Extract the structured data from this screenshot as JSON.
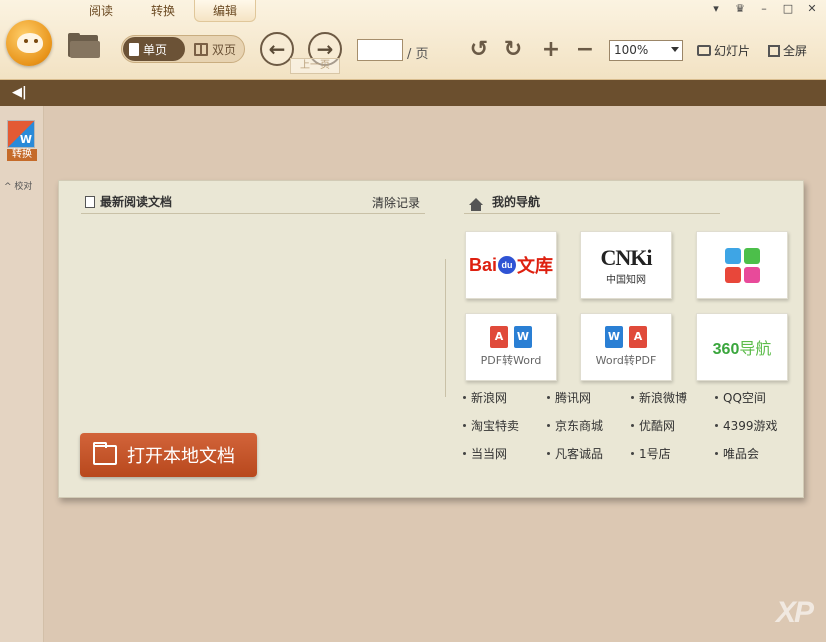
{
  "menu": {
    "tabs": [
      {
        "label": "阅读"
      },
      {
        "label": "转换"
      },
      {
        "label": "编辑"
      }
    ],
    "active_tab": "编辑"
  },
  "window_controls": [
    "▾",
    "♛",
    "–",
    "□",
    "✕"
  ],
  "toolbar": {
    "single_page_label": "单页",
    "double_page_label": "双页",
    "prev_page_glyph": "←",
    "next_page_glyph": "→",
    "prev_tooltip_text": "上一页",
    "page_input_value": "",
    "page_suffix": "/ 页",
    "rotate_left_glyph": "↺",
    "rotate_right_glyph": "↻",
    "zoom_in_glyph": "+",
    "zoom_out_glyph": "−",
    "zoom_value": "100%",
    "slideshow_label": "幻灯片",
    "fullscreen_label": "全屏"
  },
  "subbar": {
    "collapse_glyph": "◀|"
  },
  "sidebar": {
    "convert_label": "转换",
    "proofread_label": "校对"
  },
  "recent": {
    "heading": "最新阅读文档",
    "clear_label": "清除记录",
    "open_button_label": "打开本地文档"
  },
  "nav": {
    "heading": "我的导航",
    "tiles": {
      "baidu_left": "Bai",
      "baidu_paw": "du",
      "baidu_right": "文库",
      "cnki_main": "CNKi",
      "cnki_sub": "中国知网",
      "pdf2word_caption": "PDF转Word",
      "word2pdf_caption": "Word转PDF",
      "nav360_main": "360",
      "nav360_sub": "导航"
    },
    "links": [
      "新浪网",
      "腾讯网",
      "新浪微博",
      "QQ空间",
      "淘宝特卖",
      "京东商城",
      "优酷网",
      "4399游戏",
      "当当网",
      "凡客诚品",
      "1号店",
      "唯品会"
    ]
  },
  "watermark": "XP",
  "colors": {
    "brand_orange": "#e8941a",
    "accent_button": "#c1542a",
    "subbar_brown": "#6b4f2e",
    "panel_bg": "#eae7d5"
  }
}
